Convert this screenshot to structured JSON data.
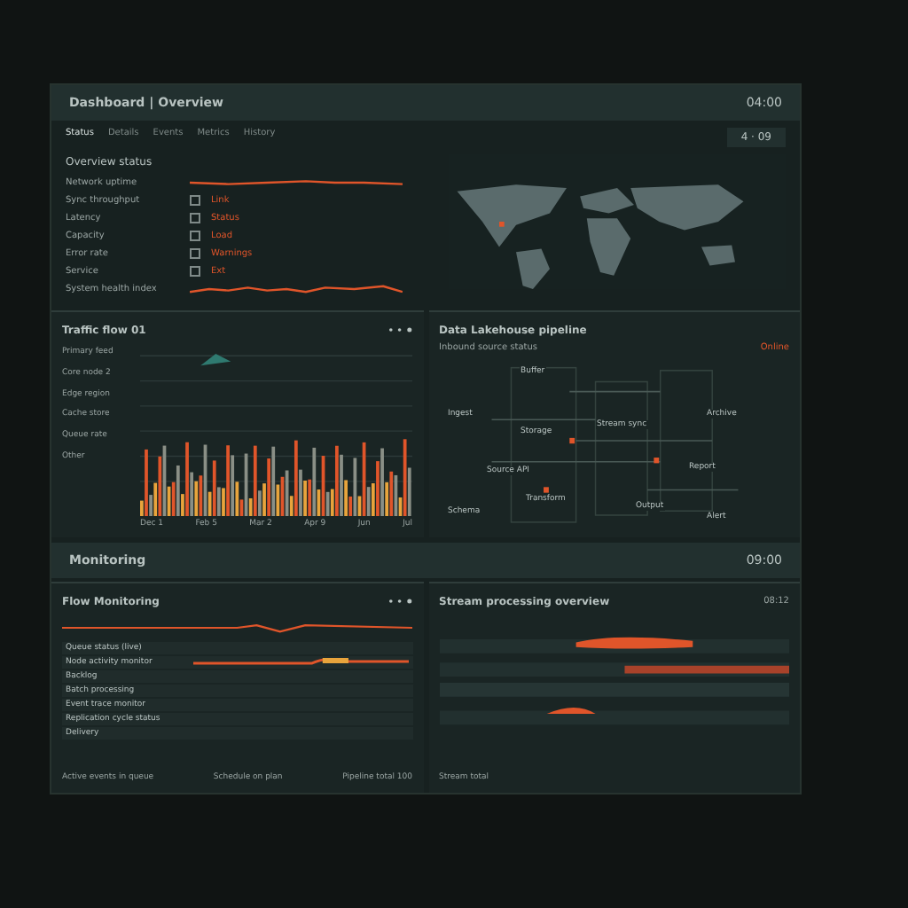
{
  "header": {
    "title": "Dashboard | Overview",
    "time": "04:00"
  },
  "tabs": [
    {
      "label": "Status",
      "selected": true
    },
    {
      "label": "Details",
      "selected": false
    },
    {
      "label": "Events",
      "selected": false
    },
    {
      "label": "Metrics",
      "selected": false
    },
    {
      "label": "History",
      "selected": false
    }
  ],
  "overview": {
    "title": "Overview status",
    "range": "4 · 09",
    "rows": [
      {
        "kind": "sparkline",
        "label": "Network uptime"
      },
      {
        "kind": "value",
        "label": "Sync throughput",
        "value": "Link"
      },
      {
        "kind": "value",
        "label": "Latency",
        "value": "Status"
      },
      {
        "kind": "value",
        "label": "Capacity",
        "value": "Load"
      },
      {
        "kind": "value",
        "label": "Error rate",
        "value": "Warnings"
      },
      {
        "kind": "value",
        "label": "Service",
        "value": "Ext"
      },
      {
        "kind": "sparkline",
        "label": "System health index"
      }
    ]
  },
  "traffic": {
    "title": "Traffic flow 01",
    "series": [
      "Primary feed",
      "Core node 2",
      "Edge region",
      "Cache store",
      "Queue rate",
      "Other"
    ],
    "x_labels": [
      "Dec 1",
      "Feb 5",
      "Mar 2",
      "Apr 9",
      "Jun",
      "Jul"
    ]
  },
  "pipeline": {
    "title": "Data Lakehouse pipeline",
    "subtitle": "Inbound source status",
    "status": "Online",
    "nodes": [
      "Ingest",
      "Source API",
      "Buffer",
      "Storage",
      "Schema",
      "Transform",
      "Stream sync",
      "Output",
      "Archive",
      "Report",
      "Alert"
    ]
  },
  "monitoring": {
    "title": "Monitoring",
    "time": "09:00",
    "left": {
      "title": "Flow Monitoring",
      "rows": [
        {
          "kind": "text",
          "label": "Queue status (live)"
        },
        {
          "kind": "trend",
          "label": "Node activity monitor"
        },
        {
          "kind": "text",
          "label": "Backlog"
        },
        {
          "kind": "text",
          "label": "Batch processing"
        },
        {
          "kind": "text",
          "label": "Event trace monitor"
        },
        {
          "kind": "text",
          "label": "Replication cycle status"
        },
        {
          "kind": "text",
          "label": "Delivery"
        }
      ],
      "footer": [
        "Active events in queue",
        "Schedule on plan",
        "Pipeline total 100"
      ]
    },
    "right": {
      "title": "Stream processing overview",
      "time": "08:12",
      "footer": "Stream total"
    }
  }
}
